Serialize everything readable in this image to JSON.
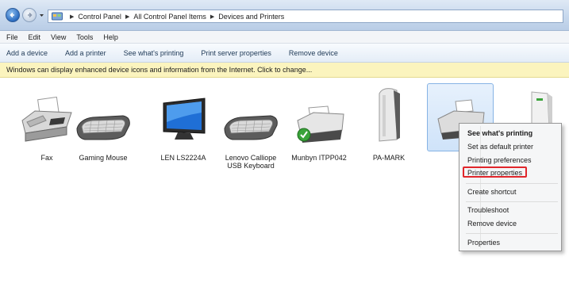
{
  "address_bar": {
    "breadcrumbs": [
      "Control Panel",
      "All Control Panel Items",
      "Devices and Printers"
    ],
    "icons": {
      "back": "back-arrow-icon",
      "forward": "forward-arrow-icon",
      "folder": "control-panel-icon"
    }
  },
  "menu": [
    "File",
    "Edit",
    "View",
    "Tools",
    "Help"
  ],
  "command_bar": [
    "Add a device",
    "Add a printer",
    "See what's printing",
    "Print server properties",
    "Remove device"
  ],
  "info_bar": {
    "text": "Windows can display enhanced device icons and information from the Internet. Click to change..."
  },
  "devices": [
    {
      "name": "Fax",
      "icon": "fax-icon"
    },
    {
      "name": "Gaming Mouse",
      "icon": "keyboard-icon"
    },
    {
      "name": "LEN LS2224A",
      "icon": "monitor-icon"
    },
    {
      "name": "Lenovo Calliope USB Keyboard",
      "icon": "keyboard-icon"
    },
    {
      "name": "Munbyn ITPP042",
      "icon": "printer-default-icon"
    },
    {
      "name": "PA-MARK",
      "icon": "tower-drive-icon"
    },
    {
      "name": "",
      "icon": "printer-icon",
      "selected": true
    },
    {
      "name": "",
      "icon": "computer-tower-icon"
    }
  ],
  "context_menu": {
    "items": [
      "See what's printing",
      "Set as default printer",
      "Printing preferences",
      "Printer properties",
      "Create shortcut",
      "Troubleshoot",
      "Remove device",
      "Properties"
    ],
    "highlighted": "Printer properties",
    "highlight_color": "#e0262b"
  }
}
